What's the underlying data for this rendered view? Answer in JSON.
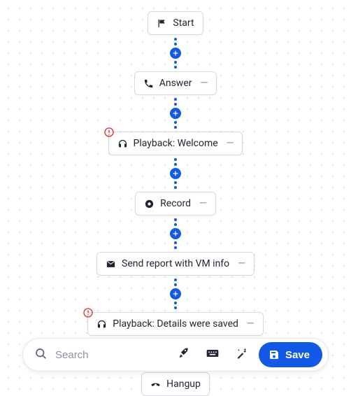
{
  "colors": {
    "accent": "#1259e6",
    "warn": "#e02c2c"
  },
  "flow": {
    "nodes": [
      {
        "id": "start",
        "icon": "flag",
        "label": "Start",
        "collapsible": false,
        "warning": false
      },
      {
        "id": "answer",
        "icon": "phone",
        "label": "Answer",
        "collapsible": true,
        "warning": false
      },
      {
        "id": "pb1",
        "icon": "headphones",
        "label": "Playback: Welcome",
        "collapsible": true,
        "warning": true
      },
      {
        "id": "record",
        "icon": "record",
        "label": "Record",
        "collapsible": true,
        "warning": false
      },
      {
        "id": "report",
        "icon": "envelope",
        "label": "Send report with VM info",
        "collapsible": true,
        "warning": false
      },
      {
        "id": "pb2",
        "icon": "headphones",
        "label": "Playback: Details were saved",
        "collapsible": true,
        "warning": true
      },
      {
        "id": "hangup",
        "icon": "phone-down",
        "label": "Hangup",
        "collapsible": false,
        "warning": false
      }
    ]
  },
  "toolbar": {
    "search_placeholder": "Search",
    "save_label": "Save"
  }
}
